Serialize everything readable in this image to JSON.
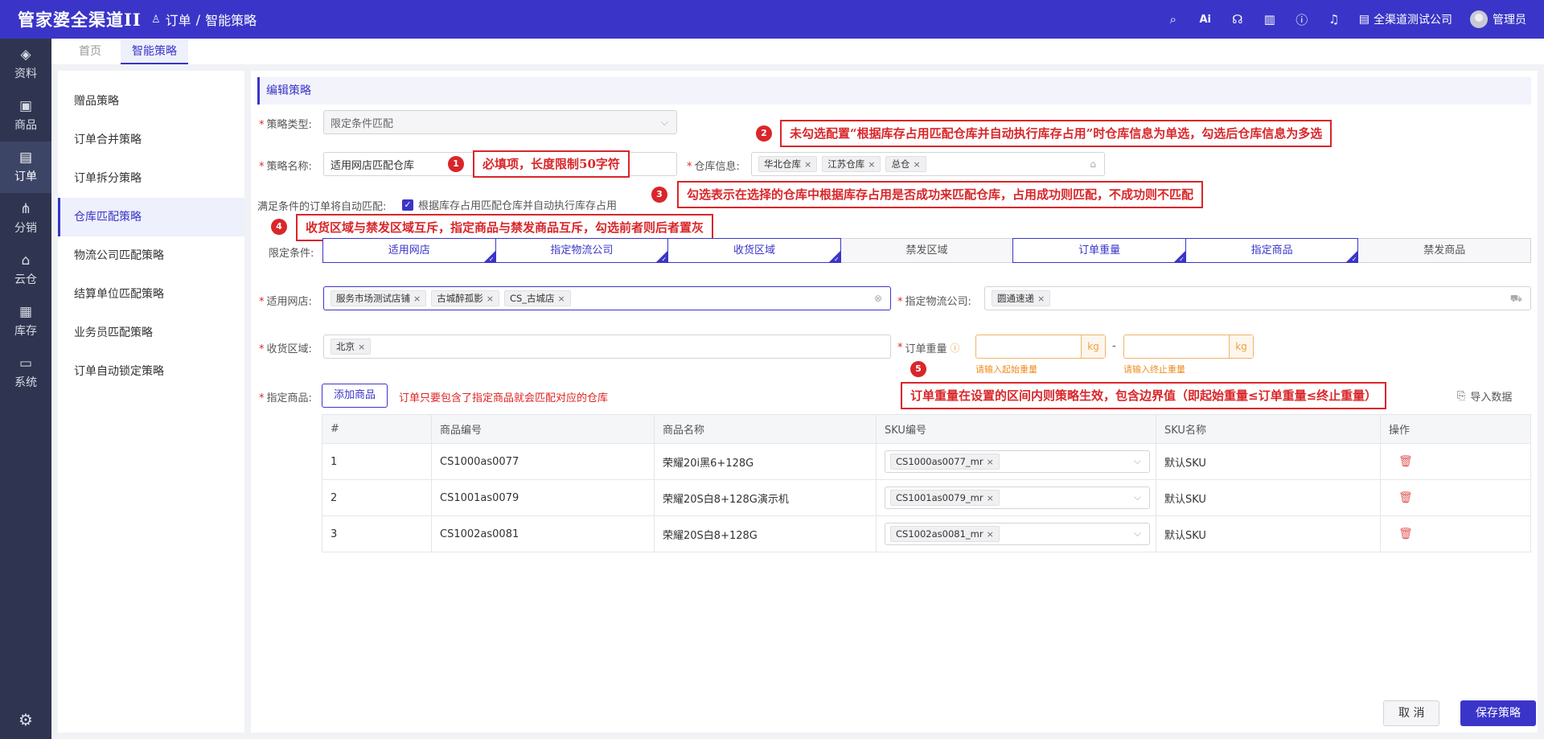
{
  "app": {
    "logo": "管家婆全渠道II",
    "breadcrumb": [
      "订单",
      "智能策略"
    ],
    "company": "全渠道测试公司",
    "user": "管理员"
  },
  "icons": {
    "top": [
      "search-icon",
      "ai-icon",
      "support-icon",
      "book-icon",
      "help-icon",
      "bell-icon"
    ]
  },
  "nav": {
    "items": [
      {
        "label": "资料",
        "icon": "layers-icon"
      },
      {
        "label": "商品",
        "icon": "box-icon"
      },
      {
        "label": "订单",
        "icon": "order-icon"
      },
      {
        "label": "分销",
        "icon": "distribution-icon"
      },
      {
        "label": "云仓",
        "icon": "cloud-warehouse-icon"
      },
      {
        "label": "库存",
        "icon": "inventory-icon"
      },
      {
        "label": "系统",
        "icon": "monitor-icon"
      }
    ],
    "active": "订单"
  },
  "tabs": [
    "首页",
    "智能策略"
  ],
  "strategies": [
    "赠品策略",
    "订单合并策略",
    "订单拆分策略",
    "仓库匹配策略",
    "物流公司匹配策略",
    "结算单位匹配策略",
    "业务员匹配策略",
    "订单自动锁定策略"
  ],
  "form": {
    "section_title": "编辑策略",
    "type_label": "策略类型:",
    "type_value": "限定条件匹配",
    "name_label": "策略名称:",
    "name_value": "适用网店匹配仓库",
    "warehouse_label": "仓库信息:",
    "warehouses": [
      "华北仓库",
      "江苏仓库",
      "总仓"
    ],
    "auto_label": "满足条件的订单将自动匹配:",
    "auto_checkbox": "根据库存占用匹配仓库并自动执行库存占用",
    "cond_label": "限定条件:",
    "conditions": [
      {
        "label": "适用网店",
        "selected": true
      },
      {
        "label": "指定物流公司",
        "selected": true
      },
      {
        "label": "收货区域",
        "selected": true
      },
      {
        "label": "禁发区域",
        "selected": false
      },
      {
        "label": "订单重量",
        "selected": true
      },
      {
        "label": "指定商品",
        "selected": true
      },
      {
        "label": "禁发商品",
        "selected": false
      }
    ],
    "shop_label": "适用网店:",
    "shops": [
      "服务市场测试店铺",
      "古城醉孤影",
      "CS_古城店"
    ],
    "logistics_label": "指定物流公司:",
    "logistics": [
      "圆通速递"
    ],
    "region_label": "收货区域:",
    "regions": [
      "北京"
    ],
    "weight_label": "订单重量",
    "weight_unit": "kg",
    "weight_dash": "-",
    "weight_start_hint": "请输入起始重量",
    "weight_end_hint": "请输入终止重量",
    "goods_label": "指定商品:",
    "add_goods": "添加商品",
    "goods_hint": "订单只要包含了指定商品就会匹配对应的仓库",
    "import": "导入数据"
  },
  "table": {
    "headers": [
      "#",
      "商品编号",
      "商品名称",
      "SKU编号",
      "SKU名称",
      "操作"
    ],
    "rows": [
      {
        "no": "1",
        "code": "CS1000as0077",
        "name": "荣耀20i黑6+128G",
        "sku": "CS1000as0077_mr",
        "sku_name": "默认SKU"
      },
      {
        "no": "2",
        "code": "CS1001as0079",
        "name": "荣耀20S白8+128G演示机",
        "sku": "CS1001as0079_mr",
        "sku_name": "默认SKU"
      },
      {
        "no": "3",
        "code": "CS1002as0081",
        "name": "荣耀20S白8+128G",
        "sku": "CS1002as0081_mr",
        "sku_name": "默认SKU"
      }
    ]
  },
  "callouts": [
    {
      "n": "1",
      "text": "必填项，长度限制50字符"
    },
    {
      "n": "2",
      "text": "未勾选配置“根据库存占用匹配仓库并自动执行库存占用”时仓库信息为单选，勾选后仓库信息为多选"
    },
    {
      "n": "3",
      "text": "勾选表示在选择的仓库中根据库存占用是否成功来匹配仓库，占用成功则匹配，不成功则不匹配"
    },
    {
      "n": "4",
      "text": "收货区域与禁发区域互斥，指定商品与禁发商品互斥，勾选前者则后者置灰"
    },
    {
      "n": "5",
      "text": "订单重量在设置的区间内则策略生效，包含边界值（即起始重量≤订单重量≤终止重量）"
    }
  ],
  "footer": {
    "cancel": "取 消",
    "save": "保存策略"
  },
  "colors": {
    "brand": "#3a35c8",
    "nav_bg": "#2f3550",
    "callout": "#d9262a",
    "warn": "#f0a040"
  }
}
